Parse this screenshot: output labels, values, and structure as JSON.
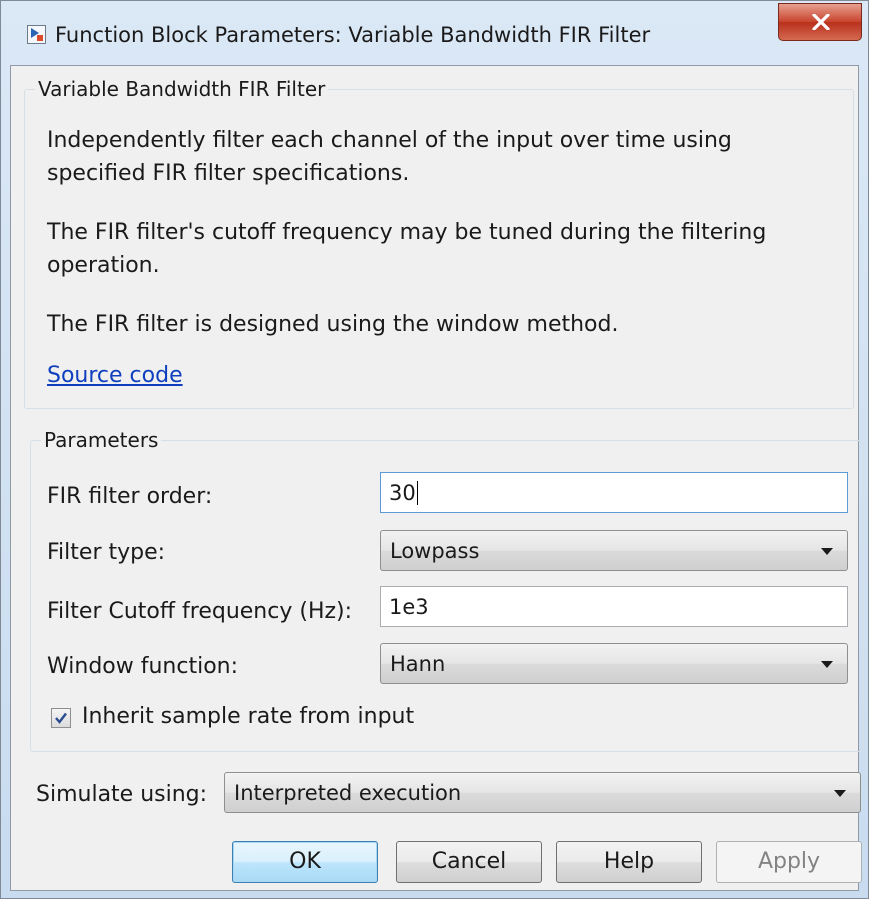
{
  "window": {
    "title": "Function Block Parameters: Variable Bandwidth FIR Filter",
    "close_glyph": "X"
  },
  "description_group": {
    "legend": "Variable Bandwidth FIR Filter",
    "para1": "Independently filter each channel of the input over time using specified FIR filter specifications.",
    "para2": "The FIR filter's cutoff frequency may be tuned during the filtering operation.",
    "para3": "The FIR filter is designed using the window method.",
    "source_link": "Source code"
  },
  "parameters": {
    "legend": "Parameters",
    "filter_order_label": "FIR filter order:",
    "filter_order_value": "30",
    "filter_type_label": "Filter type:",
    "filter_type_value": "Lowpass",
    "cutoff_label": "Filter Cutoff frequency (Hz):",
    "cutoff_value": "1e3",
    "window_label": "Window function:",
    "window_value": "Hann",
    "inherit_label": "Inherit sample rate from input",
    "inherit_checked": true
  },
  "simulate": {
    "label": "Simulate using:",
    "value": "Interpreted execution"
  },
  "buttons": {
    "ok": "OK",
    "cancel": "Cancel",
    "help": "Help",
    "apply": "Apply"
  },
  "colors": {
    "link": "#0f3fbe",
    "close_button": "#c8432c",
    "default_button_border": "#3c7fb1"
  }
}
